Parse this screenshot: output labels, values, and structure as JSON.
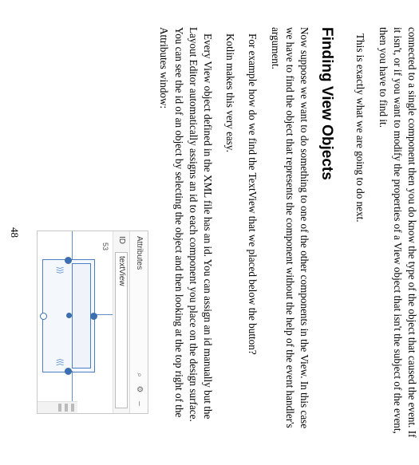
{
  "paragraphs": {
    "p1": "connected to a single component then you do know the type of the object that caused the event. If it isn't, or if you want to modify the properties of a View object that isn't the subject of the event, then you have to find it.",
    "p2": "This is exactly what we are going to do next.",
    "p3": "Now suppose we want to do something to one of the other components in the View. In this case we have to find the object that represents the component without the help of the event handler's argument.",
    "p4": "For example how do we find the TextView that we placed below the button?",
    "p5": "Kotlin makes this very easy.",
    "p6": "Every View object defined in the XML file has an id. You can assign an id manually but the Layout Editor automatically assigns an id to each component you place on the design surface. You can see the id of an object by selecting the object and then looking at the top right of the Attributes window:"
  },
  "heading": "Finding View Objects",
  "figure": {
    "title": "Attributes",
    "row2_label": "ID",
    "id_value": "textView",
    "size_label": "53",
    "icons": {
      "search": "⌕",
      "gear": "⚙",
      "minimize": "–"
    }
  },
  "page_number": "48"
}
